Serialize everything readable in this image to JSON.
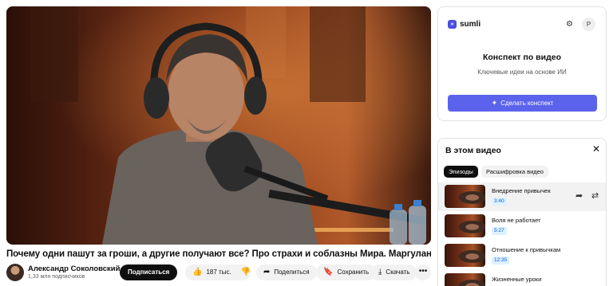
{
  "video": {
    "title": "Почему одни пашут за гроши, а другие получают все? Про страхи и соблазны Мира. Маргулан Сейсембаев"
  },
  "channel": {
    "name": "Александр Соколовский",
    "verified_glyph": "✓",
    "subscribers": "1,33 млн подписчиков",
    "subscribe_label": "Подписаться"
  },
  "actions": {
    "likes": "187 тыс.",
    "share_label": "Поделиться",
    "save_label": "Сохранить",
    "download_label": "Скачать",
    "more_glyph": "•••"
  },
  "icons": {
    "like": "👍",
    "dislike": "👎",
    "share": "➦",
    "save": "🔖",
    "download": "⤓",
    "settings": "⚙",
    "close": "✕",
    "sparkle": "✦",
    "chapter_share": "➦",
    "chapter_repeat": "⇄"
  },
  "sumli": {
    "logo_glyph": "»",
    "name": "sumli",
    "avatar_letter": "P",
    "heading": "Конспект по видео",
    "subheading": "Ключевые идеи на основе ИИ",
    "button_label": "Сделать конспект",
    "accent_color": "#5b63ec"
  },
  "chapters_panel": {
    "title": "В этом видео",
    "tabs": [
      {
        "label": "Эпизоды",
        "active": true
      },
      {
        "label": "Расшифровка видео",
        "active": false
      }
    ],
    "items": [
      {
        "title": "Внедрение привычек",
        "time": "3:40",
        "active": true
      },
      {
        "title": "Воля не работает",
        "time": "5:27",
        "active": false
      },
      {
        "title": "Отношение к привычкам",
        "time": "12:35",
        "active": false
      },
      {
        "title": "Жизненные уроки",
        "time": "",
        "active": false
      }
    ]
  }
}
